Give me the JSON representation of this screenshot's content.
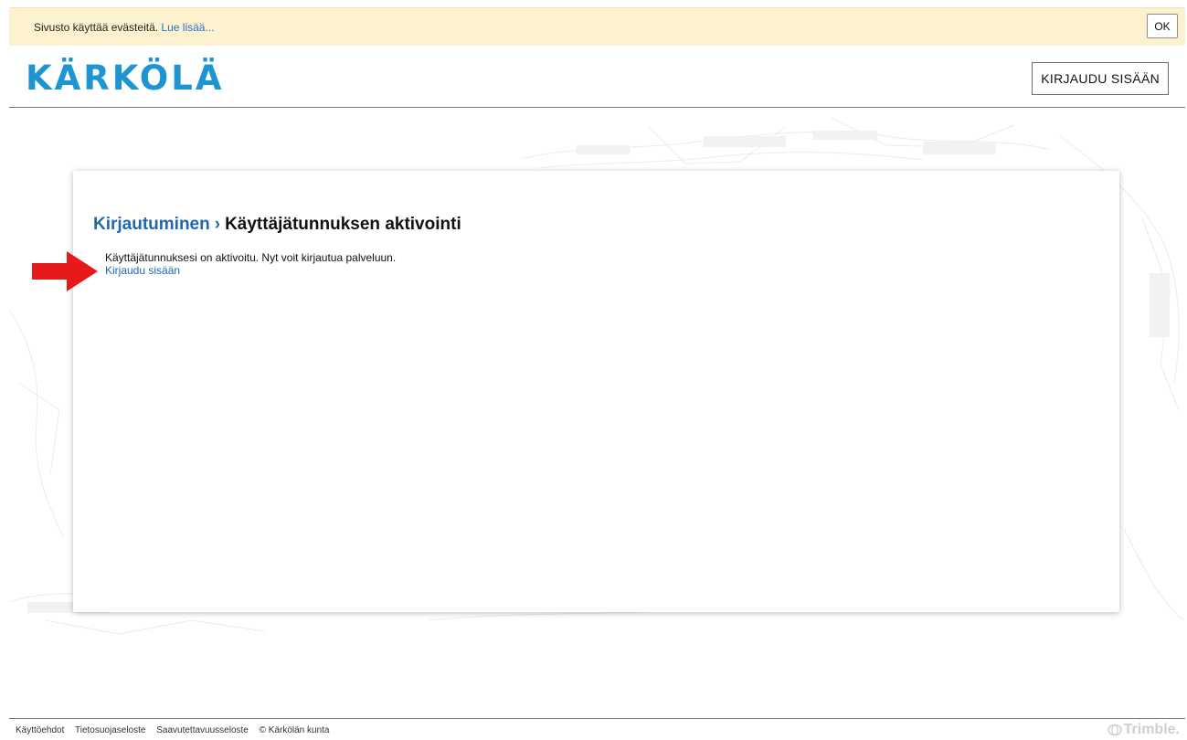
{
  "cookie_bar": {
    "text": "Sivusto käyttää evästeitä.",
    "link": "Lue lisää...",
    "ok_label": "OK",
    "background": "#fdf2cf"
  },
  "header": {
    "logo": "KÄRKÖLÄ",
    "logo_color": "#1d95d3",
    "login_label": "KIRJAUDU SISÄÄN"
  },
  "card": {
    "breadcrumb_link": "Kirjautuminen",
    "breadcrumb_sep": "›",
    "breadcrumb_current": "Käyttäjätunnuksen aktivointi",
    "message": "Käyttäjätunnuksesi on aktivoitu. Nyt voit kirjautua palveluun.",
    "login_link": "Kirjaudu sisään",
    "link_color": "#1f66b3"
  },
  "annotation": {
    "arrow_color": "#e8191a",
    "icon": "red-arrow-icon"
  },
  "footer": {
    "links": [
      "Käyttöehdot",
      "Tietosuojaseloste",
      "Saavutettavuusseloste"
    ],
    "copyright": "© Kärkölän kunta",
    "brand": "Trimble."
  }
}
